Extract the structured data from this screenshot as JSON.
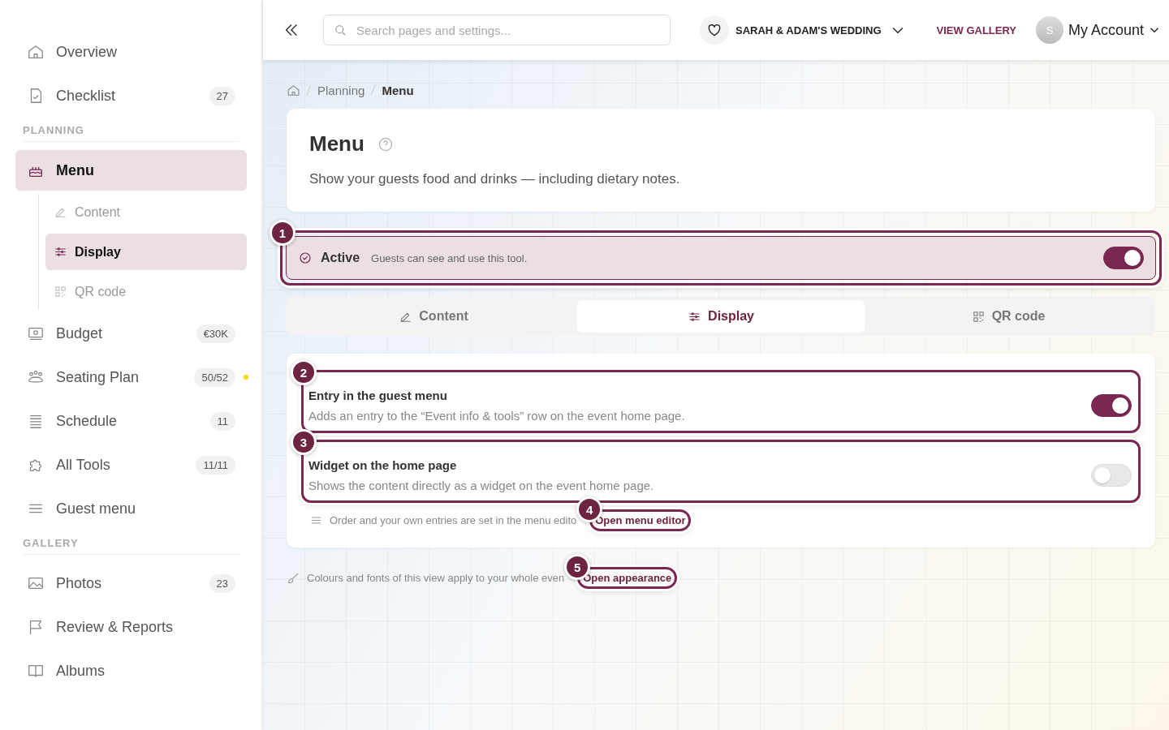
{
  "sidebar": {
    "sections": [
      {
        "items": [
          {
            "label": "Overview",
            "selected": false
          },
          {
            "label": "Checklist",
            "count": "27",
            "selected": false
          }
        ]
      },
      {
        "heading": "PLANNING",
        "items": [
          {
            "label": "Menu",
            "selected": true,
            "children": [
              {
                "label": "Content",
                "selected": false
              },
              {
                "label": "Display",
                "selected": true
              },
              {
                "label": "QR code",
                "selected": false
              }
            ]
          },
          {
            "label": "Budget",
            "count": "€30K",
            "selected": false
          },
          {
            "label": "Seating Plan",
            "count": "50/52",
            "color": "#f5d90a",
            "selected": false
          },
          {
            "label": "Schedule",
            "count": "11",
            "selected": false
          },
          {
            "label": "All Tools",
            "count": "11/11",
            "selected": false
          },
          {
            "label": "Guest menu",
            "selected": false
          }
        ]
      },
      {
        "heading": "GALLERY",
        "items": [
          {
            "label": "Photos",
            "count": "23",
            "selected": false
          },
          {
            "label": "Review & Reports",
            "selected": false
          },
          {
            "label": "Albums",
            "selected": false
          }
        ]
      }
    ]
  },
  "header": {
    "search": {
      "placeholder": "Search pages and settings..."
    },
    "event": "SARAH & ADAM'S WEDDING",
    "gallery_link": "VIEW GALLERY",
    "avatar": "S",
    "account": "My Account"
  },
  "breadcrumb": [
    "Planning",
    "Menu"
  ],
  "page": {
    "title": "Menu",
    "subtitle": "Show your guests food and drinks — including dietary notes."
  },
  "active_bar": {
    "label": "Active",
    "description": "Guests can see and use this tool.",
    "on": true,
    "callout": "1"
  },
  "tabs": [
    {
      "label": "Content",
      "selected": false
    },
    {
      "label": "Display",
      "selected": true
    },
    {
      "label": "QR code",
      "selected": false
    }
  ],
  "settings": [
    {
      "title": "Entry in the guest menu",
      "description": "Adds an entry to the “Event info & tools” row on the event home page.",
      "on": true,
      "callout": "2"
    },
    {
      "title": "Widget on the home page",
      "description": "Shows the content directly as a widget on the event home page.",
      "on": false,
      "callout": "3"
    }
  ],
  "editor_note": {
    "text": "Order and your own entries are set in the menu edito",
    "link": "Open menu editor",
    "callout": "4"
  },
  "appearance_note": {
    "text": "Colours and fonts of this view apply to your whole even",
    "link": "Open appearance",
    "callout": "5"
  }
}
